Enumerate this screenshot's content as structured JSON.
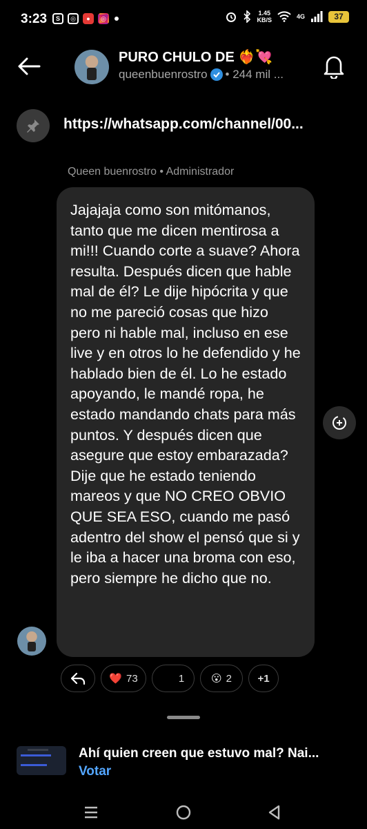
{
  "status_bar": {
    "time": "3:23",
    "net_speed_value": "1.45",
    "net_speed_unit": "KB/S",
    "signal_label": "4G",
    "battery": "37"
  },
  "header": {
    "channel_name": "PURO CHULO DE ❤️‍🔥💘",
    "handle": "queenbuenrostro",
    "followers": "• 244 mil ..."
  },
  "pinned": {
    "link": "https://whatsapp.com/channel/00..."
  },
  "message": {
    "sender": "Queen buenrostro • Administrador",
    "text": "Jajajaja como son mitómanos, tanto que me dicen mentirosa a mi!!! Cuando corte a suave? Ahora resulta. Después dicen que hable mal de él? Le dije hipócrita y que no me pareció cosas que hizo pero ni hable mal, incluso en ese live y en otros lo he defendido y he hablado bien de él. Lo he estado apoyando, le mandé ropa, he estado mandando chats para más puntos. Y después dicen que asegure que estoy embarazada? Dije que he estado teniendo mareos y que NO CREO OBVIO QUE SEA ESO, cuando me pasó adentro del show el pensó que si y le iba a hacer una broma con eso, pero siempre he dicho que no."
  },
  "reactions": [
    {
      "emoji": "❤️",
      "count": "73"
    },
    {
      "emoji": "",
      "count": "1"
    },
    {
      "emoji": "😮",
      "count": "2"
    },
    {
      "emoji": "",
      "count": "+1"
    }
  ],
  "poll": {
    "title": "Ahí quien creen que estuvo mal? Nai...",
    "action": "Votar"
  },
  "colors": {
    "background": "#000000",
    "bubble": "#262626",
    "accent_link": "#53a6ff",
    "verified": "#2f8fe0"
  },
  "icons": [
    "back-arrow-icon",
    "bell-icon",
    "pin-icon",
    "add-reaction-icon",
    "reply-icon",
    "verified-icon",
    "menu-icon",
    "home-icon",
    "back-icon"
  ]
}
